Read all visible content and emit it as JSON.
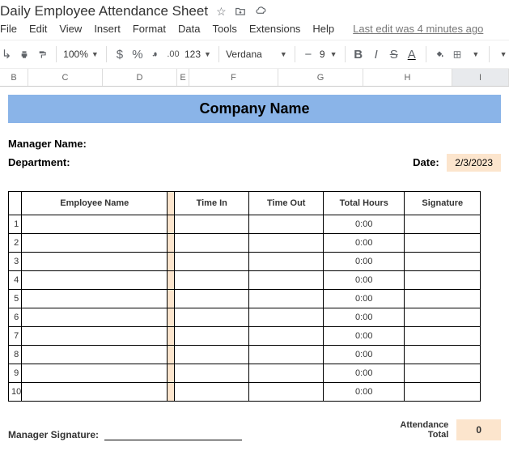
{
  "doc_title": "Daily Employee Attendance Sheet",
  "last_edit": "Last edit was 4 minutes ago",
  "menus": [
    "File",
    "Edit",
    "View",
    "Insert",
    "Format",
    "Data",
    "Tools",
    "Extensions",
    "Help"
  ],
  "zoom": "100%",
  "decimal_fmt": ".00",
  "number_fmt": "123",
  "font_name": "Verdana",
  "font_size": "9",
  "columns": [
    "B",
    "C",
    "D",
    "E",
    "F",
    "G",
    "H",
    "I"
  ],
  "banner_title": "Company Name",
  "manager_name_label": "Manager Name:",
  "department_label": "Department:",
  "date_label": "Date:",
  "date_value": "2/3/2023",
  "table_headers": {
    "row_num": "",
    "employee_name": "Employee Name",
    "time_in": "Time In",
    "time_out": "Time Out",
    "total_hours": "Total Hours",
    "signature": "Signature"
  },
  "rows": [
    {
      "n": "1",
      "total": "0:00"
    },
    {
      "n": "2",
      "total": "0:00"
    },
    {
      "n": "3",
      "total": "0:00"
    },
    {
      "n": "4",
      "total": "0:00"
    },
    {
      "n": "5",
      "total": "0:00"
    },
    {
      "n": "6",
      "total": "0:00"
    },
    {
      "n": "7",
      "total": "0:00"
    },
    {
      "n": "8",
      "total": "0:00"
    },
    {
      "n": "9",
      "total": "0:00"
    },
    {
      "n": "10",
      "total": "0:00"
    }
  ],
  "manager_signature_label": "Manager Signature:",
  "attendance_total_label": "Attendance\nTotal",
  "attendance_total_value": "0",
  "icons": {
    "star": "star-icon",
    "move": "move-folder-icon",
    "cloud": "cloud-sync-icon",
    "print": "print-icon",
    "paint": "paint-format-icon",
    "currency": "$",
    "percent": "%",
    "dec_minus": "decrease-decimal-icon",
    "fill": "fill-color-icon",
    "borders": "borders-icon",
    "merge": "merge-cells-icon",
    "align": "align-icon"
  }
}
